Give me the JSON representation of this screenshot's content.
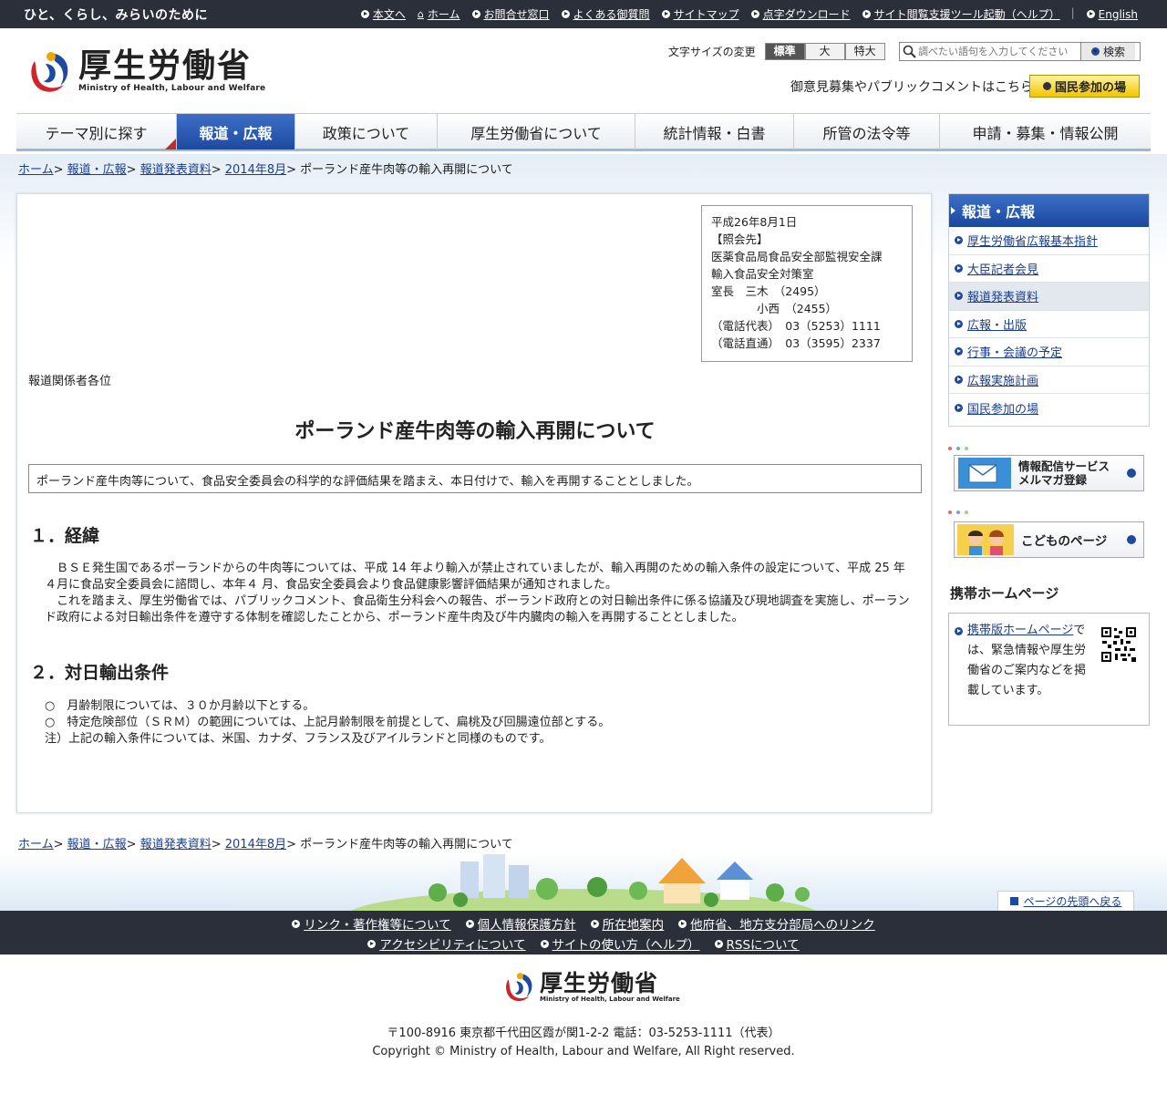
{
  "topbar": {
    "tagline": "ひと、くらし、みらいのために",
    "links": [
      "本文へ",
      "ホーム",
      "お問合せ窓口",
      "よくある御質問",
      "サイトマップ",
      "点字ダウンロード",
      "サイト閲覧支援ツール起動（ヘルプ）"
    ],
    "english": "English"
  },
  "header": {
    "logo_jp": "厚生労働省",
    "logo_en": "Ministry of Health, Labour and Welfare",
    "fontsize_label": "文字サイズの変更",
    "fontsize_options": [
      "標準",
      "大",
      "特大"
    ],
    "search_placeholder": "調べたい語句を入力してください",
    "search_button": "検索",
    "public_comment": "御意見募集やパブリックコメントはこちら",
    "kokumin_button": "国民参加の場"
  },
  "gnav": [
    "テーマ別に探す",
    "報道・広報",
    "政策について",
    "厚生労働省について",
    "統計情報・白書",
    "所管の法令等",
    "申請・募集・情報公開"
  ],
  "breadcrumb": {
    "items": [
      "ホーム",
      "報道・広報",
      "報道発表資料",
      "2014年8月"
    ],
    "current": "ポーランド産牛肉等の輸入再開について"
  },
  "contact": {
    "lines": [
      "平成26年8月1日",
      "【照会先】",
      "医薬食品局食品安全部監視安全課",
      "輸入食品安全対策室",
      "室長　三木　（2495）",
      "　　　　小西　（2455）",
      "（電話代表）　03（5253）1111",
      "（電話直通）　03（3595）2337"
    ]
  },
  "article": {
    "greeting": "報道関係者各位",
    "title": "ポーランド産牛肉等の輸入再開について",
    "summary": "ポーランド産牛肉等について、食品安全委員会の科学的な評価結果を踏まえ、本日付けで、輸入を再開することとしました。",
    "section1_heading": "１．経緯",
    "section1_p1": "ＢＳＥ発生国であるポーランドからの牛肉等については、平成 14 年より輸入が禁止されていましたが、輸入再開のための輸入条件の設定について、平成 25 年４月に食品安全委員会に諮問し、本年４ 月、食品安全委員会より食品健康影響評価結果が通知されました。",
    "section1_p2": "これを踏まえ、厚生労働省では、パブリックコメント、食品衛生分科会への報告、ポーランド政府との対日輸出条件に係る協議及び現地調査を実施し、ポーランド政府による対日輸出条件を遵守する体制を確認したことから、ポーランド産牛肉及び牛内臓肉の輸入を再開することとしました。",
    "section2_heading": "２．対日輸出条件",
    "conditions": [
      "○　月齢制限については、３０か月齢以下とする。",
      "○　特定危険部位（ＳＲＭ）の範囲については、上記月齢制限を前提として、扁桃及び回腸遠位部とする。",
      "注）上記の輸入条件については、米国、カナダ、フランス及びアイルランドと同様のものです。"
    ]
  },
  "sidebar": {
    "heading": "報道・広報",
    "items": [
      "厚生労働省広報基本指針",
      "大臣記者会見",
      "報道発表資料",
      "広報・出版",
      "行事・会議の予定",
      "広報実施計画",
      "国民参加の場"
    ],
    "banner1_line1": "情報配信サービス",
    "banner1_line2": "メルマガ登録",
    "banner2": "こどものページ",
    "mobile_heading": "携帯ホームページ",
    "mobile_link": "携帯版ホームページ",
    "mobile_text": "では、緊急情報や厚生労働省のご案内などを掲載しています。"
  },
  "footer": {
    "to_top": "ページの先頭へ戻る",
    "row1": [
      "リンク・著作権等について",
      "個人情報保護方針",
      "所在地案内",
      "他府省、地方支分部局へのリンク"
    ],
    "row2": [
      "アクセシビリティについて",
      "サイトの使い方（ヘルプ）",
      "RSSについて"
    ],
    "logo_jp": "厚生労働省",
    "logo_en": "Ministry of Health, Labour and Welfare",
    "address": "〒100-8916 東京都千代田区霞が関1-2-2 電話：03-5253-1111（代表）",
    "copyright": "Copyright © Ministry of Health, Labour and Welfare, All Right reserved."
  }
}
